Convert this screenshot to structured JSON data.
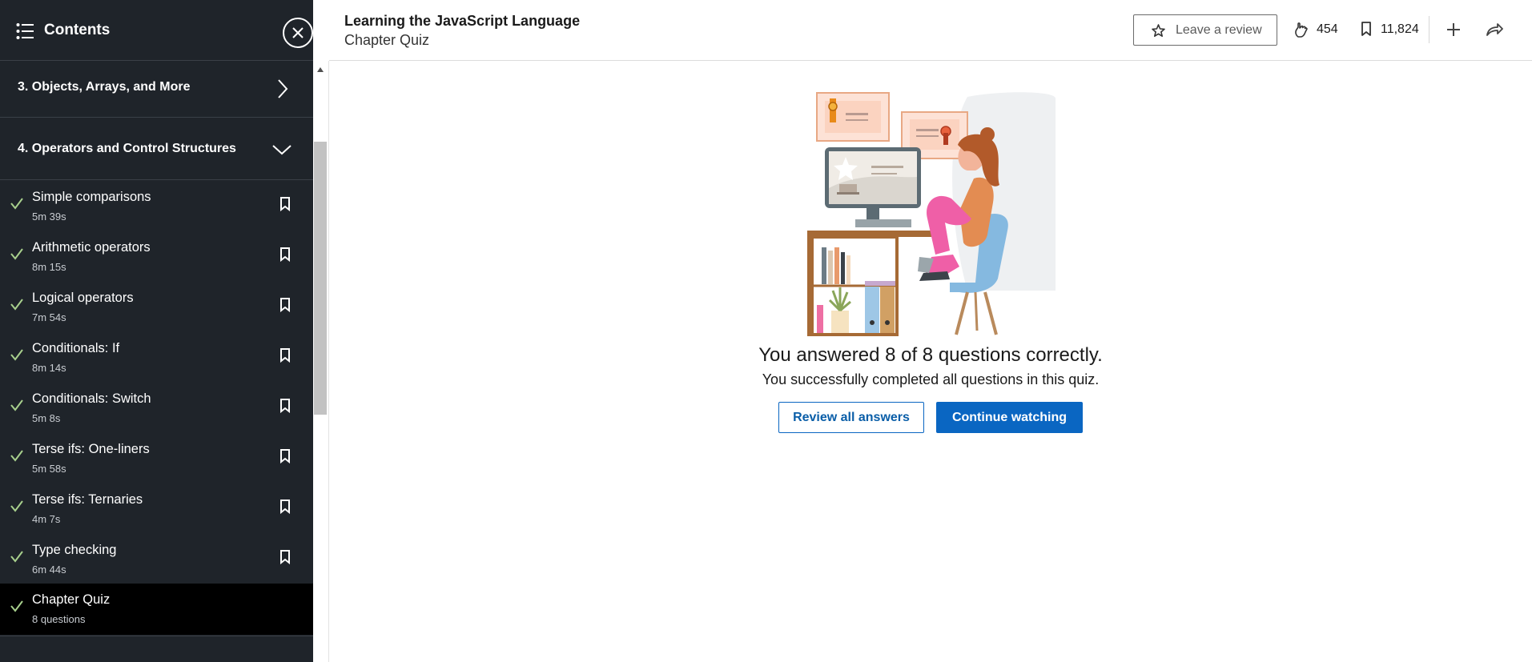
{
  "sidebar": {
    "title": "Contents",
    "chapters": [
      {
        "label": "3. Objects, Arrays, and More",
        "expanded": false
      },
      {
        "label": "4. Operators and Control Structures",
        "expanded": true
      }
    ],
    "items": [
      {
        "name": "Simple comparisons",
        "duration": "5m 39s",
        "completed": true
      },
      {
        "name": "Arithmetic operators",
        "duration": "8m 15s",
        "completed": true
      },
      {
        "name": "Logical operators",
        "duration": "7m 54s",
        "completed": true
      },
      {
        "name": "Conditionals: If",
        "duration": "8m 14s",
        "completed": true
      },
      {
        "name": "Conditionals: Switch",
        "duration": "5m 8s",
        "completed": true
      },
      {
        "name": "Terse ifs: One-liners",
        "duration": "5m 58s",
        "completed": true
      },
      {
        "name": "Terse ifs: Ternaries",
        "duration": "4m 7s",
        "completed": true
      },
      {
        "name": "Type checking",
        "duration": "6m 44s",
        "completed": true
      },
      {
        "name": "Chapter Quiz",
        "duration": "8 questions",
        "completed": true,
        "active": true
      }
    ]
  },
  "header": {
    "course_title": "Learning the JavaScript Language",
    "subtitle": "Chapter Quiz",
    "review_label": "Leave a review",
    "likes": "454",
    "saves": "11,824"
  },
  "quiz": {
    "result": "You answered 8 of 8 questions correctly.",
    "message": "You successfully completed all questions in this quiz.",
    "review_button": "Review all answers",
    "continue_button": "Continue watching"
  },
  "colors": {
    "sidebar_bg": "#1f242a",
    "check_green": "#a8d08d",
    "accent_blue": "#0a66c2"
  },
  "icons": [
    "contents-list-icon",
    "close-icon",
    "chevron-right-icon",
    "chevron-down-icon",
    "check-icon",
    "bookmark-icon",
    "star-icon",
    "like-icon",
    "plus-icon",
    "share-icon"
  ]
}
